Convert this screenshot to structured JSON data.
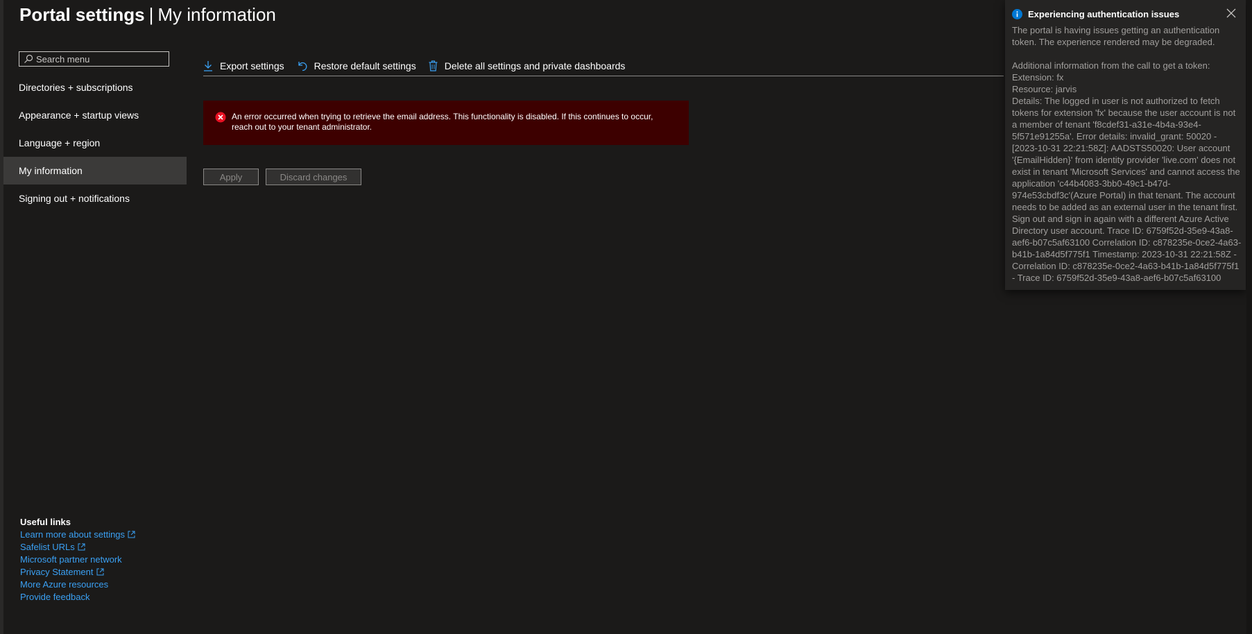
{
  "header": {
    "title_bold": "Portal settings",
    "separator": "|",
    "title_page": "My information"
  },
  "search": {
    "placeholder": "Search menu"
  },
  "sidebar": {
    "items": [
      {
        "label": "Directories + subscriptions"
      },
      {
        "label": "Appearance + startup views"
      },
      {
        "label": "Language + region"
      },
      {
        "label": "My information",
        "active": true
      },
      {
        "label": "Signing out + notifications"
      }
    ]
  },
  "useful_links": {
    "title": "Useful links",
    "items": [
      {
        "label": "Learn more about settings",
        "external": true
      },
      {
        "label": "Safelist URLs",
        "external": true
      },
      {
        "label": "Microsoft partner network",
        "external": false
      },
      {
        "label": "Privacy Statement",
        "external": true
      },
      {
        "label": "More Azure resources",
        "external": false
      },
      {
        "label": "Provide feedback",
        "external": false
      }
    ]
  },
  "toolbar": {
    "export_label": "Export settings",
    "restore_label": "Restore default settings",
    "delete_label": "Delete all settings and private dashboards"
  },
  "error_banner": {
    "message": "An error occurred when trying to retrieve the email address. This functionality is disabled. If this continues to occur, reach out to your tenant administrator."
  },
  "actions": {
    "apply_label": "Apply",
    "discard_label": "Discard changes"
  },
  "notification": {
    "title": "Experiencing authentication issues",
    "summary": "The portal is having issues getting an authentication token. The experience rendered may be degraded.",
    "info_heading": "Additional information from the call to get a token:",
    "extension": "Extension: fx",
    "resource": "Resource: jarvis",
    "details": "Details: The logged in user is not authorized to fetch tokens for extension 'fx' because the user account is not a member of tenant 'f8cdef31-a31e-4b4a-93e4-5f571e91255a'. Error details: invalid_grant: 50020 - [2023-10-31 22:21:58Z]: AADSTS50020: User account '{EmailHidden}' from identity provider 'live.com' does not exist in tenant 'Microsoft Services' and cannot access the application 'c44b4083-3bb0-49c1-b47d-974e53cbdf3c'(Azure Portal) in that tenant. The account needs to be added as an external user in the tenant first. Sign out and sign in again with a different Azure Active Directory user account. Trace ID: 6759f52d-35e9-43a8-aef6-b07c5af63100 Correlation ID: c878235e-0ce2-4a63-b41b-1a84d5f775f1 Timestamp: 2023-10-31 22:21:58Z - Correlation ID: c878235e-0ce2-4a63-b41b-1a84d5f775f1 - Trace ID: 6759f52d-35e9-43a8-aef6-b07c5af63100"
  },
  "colors": {
    "background": "#1b1a19",
    "link": "#3aa0f3",
    "accent": "#3aa0f3",
    "error_bg": "#3d0000",
    "error_icon": "#e81123",
    "info_icon": "#0078d4",
    "nav_active": "#3b3a39"
  },
  "icons": {
    "search": "search-icon",
    "export": "download-icon",
    "restore": "undo-icon",
    "delete": "trash-icon",
    "error": "error-icon",
    "info": "info-icon",
    "close": "close-icon",
    "external": "external-link-icon"
  }
}
